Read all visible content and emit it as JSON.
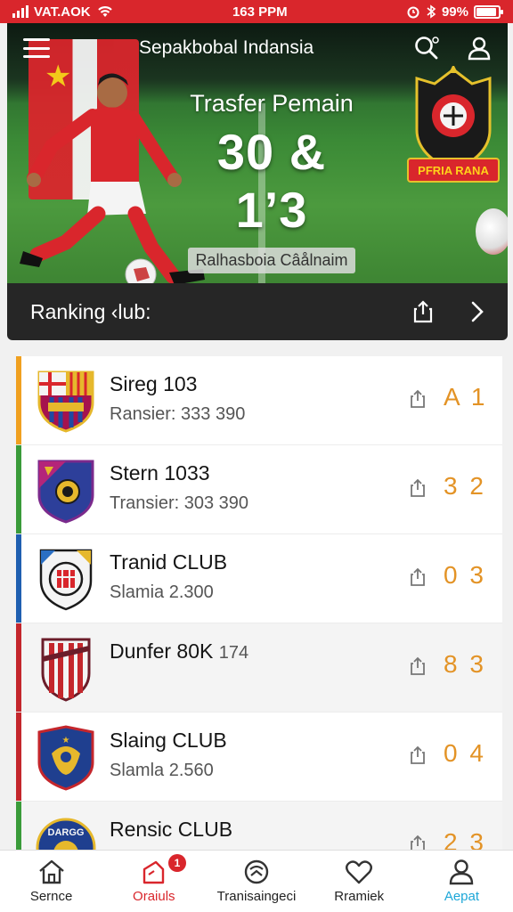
{
  "status_bar": {
    "carrier": "VAT.AOK",
    "time": "163 PPM",
    "battery": "99%",
    "battery_level": 0.9
  },
  "header": {
    "title": "Sepakbobal Indansia"
  },
  "hero": {
    "subtitle": "Trasfer Pemain",
    "headline": "30 & 1’3",
    "tag": "Ralhasboia Câålnaim",
    "crest_banner": "PFRIA RANA"
  },
  "ranking_bar": {
    "label": "Ranking ‹lub:"
  },
  "clubs": [
    {
      "name": "Sireg 103",
      "detail": "Ransier: 333 390",
      "rank": "A 1",
      "accent": "#f0a020"
    },
    {
      "name": "Stern 1033",
      "detail": "Transier: 303 390",
      "rank": "3 2",
      "accent": "#3a9b3a"
    },
    {
      "name": "Tranid CLUB",
      "detail": "Slamia 2.300",
      "rank": "0 3",
      "accent": "#1f5fb0"
    },
    {
      "name": "Dunfer 80K",
      "name_extra": "174",
      "detail": "",
      "rank": "8 3",
      "accent": "#c4262c"
    },
    {
      "name": "Slaing CLUB",
      "detail": "Slamla 2.560",
      "rank": "0 4",
      "accent": "#c4262c"
    },
    {
      "name": "Rensic CLUB",
      "detail": "",
      "rank": "2 3",
      "accent": "#3a9b3a",
      "logo_text": "DARGG"
    }
  ],
  "bottom_nav": [
    {
      "label": "Sernce",
      "icon": "home-icon"
    },
    {
      "label": "Oraiuls",
      "icon": "news-icon",
      "badge": "1"
    },
    {
      "label": "Tranisaingeci",
      "icon": "ball-icon"
    },
    {
      "label": "Rramiek",
      "icon": "heart-icon"
    },
    {
      "label": "Aepat",
      "icon": "profile-icon"
    }
  ],
  "colors": {
    "primary": "#d9262c",
    "rank_accent": "#e39326",
    "nav_active": "#1ea7d8"
  }
}
